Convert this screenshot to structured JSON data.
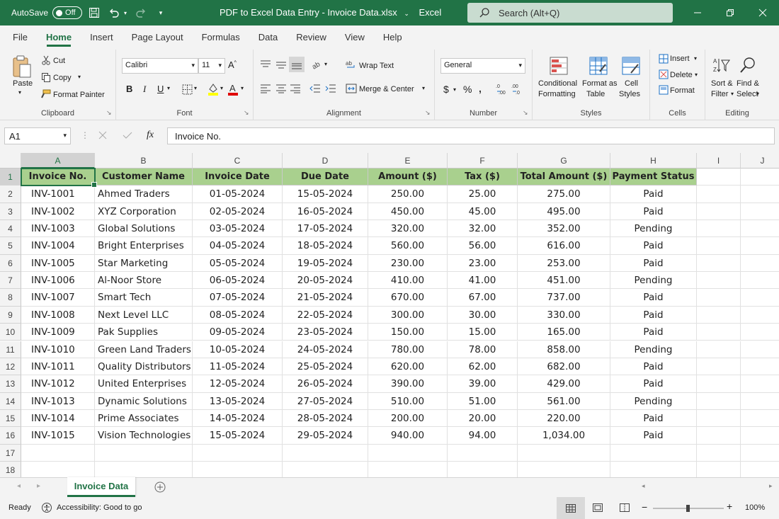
{
  "titlebar": {
    "autosave_label": "AutoSave",
    "autosave_state": "Off",
    "document_title": "PDF to Excel Data Entry - Invoice Data.xlsx",
    "app_name": "Excel",
    "search_placeholder": "Search (Alt+Q)"
  },
  "tabs": [
    "File",
    "Home",
    "Insert",
    "Page Layout",
    "Formulas",
    "Data",
    "Review",
    "View",
    "Help"
  ],
  "active_tab": "Home",
  "ribbon": {
    "clipboard": {
      "label": "Clipboard",
      "paste": "Paste",
      "cut": "Cut",
      "copy": "Copy",
      "format_painter": "Format Painter"
    },
    "font": {
      "label": "Font",
      "font_name": "Calibri",
      "font_size": "11",
      "bold": "B",
      "italic": "I",
      "underline": "U"
    },
    "alignment": {
      "label": "Alignment",
      "wrap_text": "Wrap Text",
      "merge_center": "Merge & Center"
    },
    "number": {
      "label": "Number",
      "format": "General",
      "currency": "$",
      "percent": "%"
    },
    "styles": {
      "label": "Styles",
      "conditional_formatting_1": "Conditional",
      "conditional_formatting_2": "Formatting",
      "format_as_table_1": "Format as",
      "format_as_table_2": "Table",
      "cell_styles_1": "Cell",
      "cell_styles_2": "Styles"
    },
    "cells": {
      "label": "Cells",
      "insert": "Insert",
      "delete": "Delete",
      "format": "Format"
    },
    "editing": {
      "label": "Editing",
      "sort_filter_1": "Sort &",
      "sort_filter_2": "Filter",
      "find_select_1": "Find &",
      "find_select_2": "Select"
    }
  },
  "formula_bar": {
    "name_box": "A1",
    "fx": "fx",
    "content": "Invoice No."
  },
  "columns": [
    "A",
    "B",
    "C",
    "D",
    "E",
    "F",
    "G",
    "H",
    "I",
    "J"
  ],
  "row_numbers": [
    "1",
    "2",
    "3",
    "4",
    "5",
    "6",
    "7",
    "8",
    "9",
    "10",
    "11",
    "12",
    "13",
    "14",
    "15",
    "16",
    "17",
    "18"
  ],
  "table": {
    "headers": [
      "Invoice No.",
      "Customer Name",
      "Invoice Date",
      "Due Date",
      "Amount ($)",
      "Tax ($)",
      "Total Amount ($)",
      "Payment Status"
    ],
    "rows": [
      [
        "INV-1001",
        "Ahmed Traders",
        "01-05-2024",
        "15-05-2024",
        "250.00",
        "25.00",
        "275.00",
        "Paid"
      ],
      [
        "INV-1002",
        "XYZ Corporation",
        "02-05-2024",
        "16-05-2024",
        "450.00",
        "45.00",
        "495.00",
        "Paid"
      ],
      [
        "INV-1003",
        "Global Solutions",
        "03-05-2024",
        "17-05-2024",
        "320.00",
        "32.00",
        "352.00",
        "Pending"
      ],
      [
        "INV-1004",
        "Bright Enterprises",
        "04-05-2024",
        "18-05-2024",
        "560.00",
        "56.00",
        "616.00",
        "Paid"
      ],
      [
        "INV-1005",
        "Star Marketing",
        "05-05-2024",
        "19-05-2024",
        "230.00",
        "23.00",
        "253.00",
        "Paid"
      ],
      [
        "INV-1006",
        "Al-Noor Store",
        "06-05-2024",
        "20-05-2024",
        "410.00",
        "41.00",
        "451.00",
        "Pending"
      ],
      [
        "INV-1007",
        "Smart Tech",
        "07-05-2024",
        "21-05-2024",
        "670.00",
        "67.00",
        "737.00",
        "Paid"
      ],
      [
        "INV-1008",
        "Next Level LLC",
        "08-05-2024",
        "22-05-2024",
        "300.00",
        "30.00",
        "330.00",
        "Paid"
      ],
      [
        "INV-1009",
        "Pak Supplies",
        "09-05-2024",
        "23-05-2024",
        "150.00",
        "15.00",
        "165.00",
        "Paid"
      ],
      [
        "INV-1010",
        "Green Land Traders",
        "10-05-2024",
        "24-05-2024",
        "780.00",
        "78.00",
        "858.00",
        "Pending"
      ],
      [
        "INV-1011",
        "Quality Distributors",
        "11-05-2024",
        "25-05-2024",
        "620.00",
        "62.00",
        "682.00",
        "Paid"
      ],
      [
        "INV-1012",
        "United Enterprises",
        "12-05-2024",
        "26-05-2024",
        "390.00",
        "39.00",
        "429.00",
        "Paid"
      ],
      [
        "INV-1013",
        "Dynamic Solutions",
        "13-05-2024",
        "27-05-2024",
        "510.00",
        "51.00",
        "561.00",
        "Pending"
      ],
      [
        "INV-1014",
        "Prime Associates",
        "14-05-2024",
        "28-05-2024",
        "200.00",
        "20.00",
        "220.00",
        "Paid"
      ],
      [
        "INV-1015",
        "Vision Technologies",
        "15-05-2024",
        "29-05-2024",
        "940.00",
        "94.00",
        "1,034.00",
        "Paid"
      ]
    ]
  },
  "sheet_tabs": [
    "Invoice Data"
  ],
  "statusbar": {
    "ready": "Ready",
    "accessibility": "Accessibility: Good to go",
    "zoom": "100%"
  },
  "colors": {
    "accent": "#217346",
    "header_fill": "#a9d08e"
  }
}
